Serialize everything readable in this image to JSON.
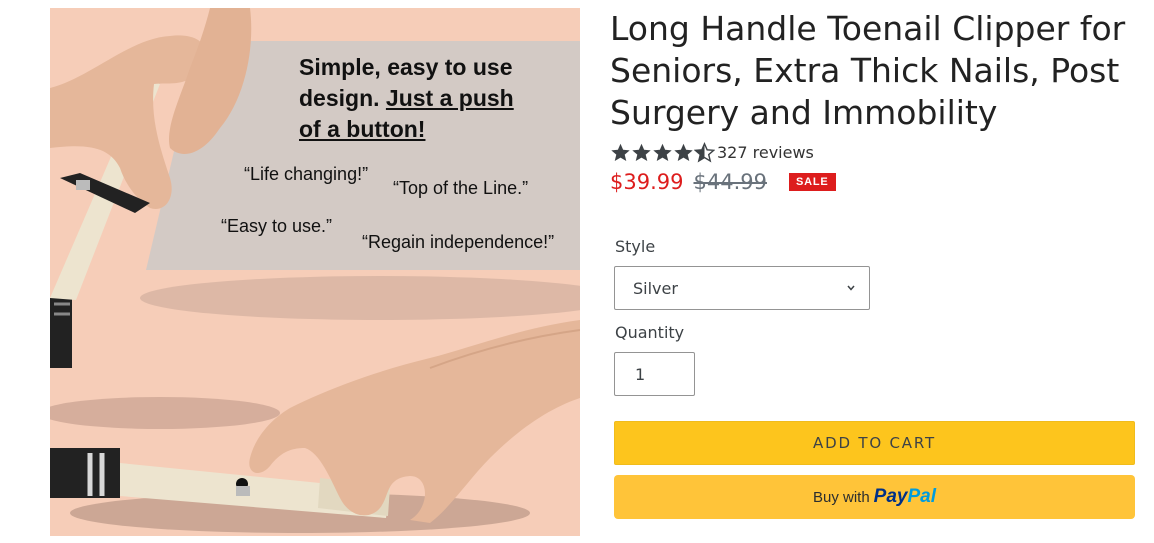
{
  "product_image": {
    "headline_line1": "Simple, easy to use",
    "headline_line2a": "design.",
    "headline_line2b": "Just a push",
    "headline_line3": "of a button!",
    "quotes": [
      "“Life changing!”",
      "“Top of the Line.”",
      "“Easy to use.”",
      "“Regain independence!”"
    ]
  },
  "product": {
    "title": "Long Handle Toenail Clipper for Seniors, Extra Thick Nails, Post Surgery and Immobility",
    "rating_value": 4.5,
    "reviews_text": "327 reviews",
    "sale_price": "$39.99",
    "regular_price": "$44.99",
    "sale_badge": "SALE"
  },
  "options": {
    "style_label": "Style",
    "style_value": "Silver",
    "quantity_label": "Quantity",
    "quantity_value": "1"
  },
  "buttons": {
    "add_to_cart": "ADD TO CART",
    "buy_with": "Buy with",
    "paypal_pay": "Pay",
    "paypal_pal": "Pal"
  },
  "colors": {
    "sale_red": "#dd1d1d",
    "add_to_cart_yellow": "#fdc51d",
    "paypal_yellow": "#ffc439",
    "star": "#3d4246"
  }
}
